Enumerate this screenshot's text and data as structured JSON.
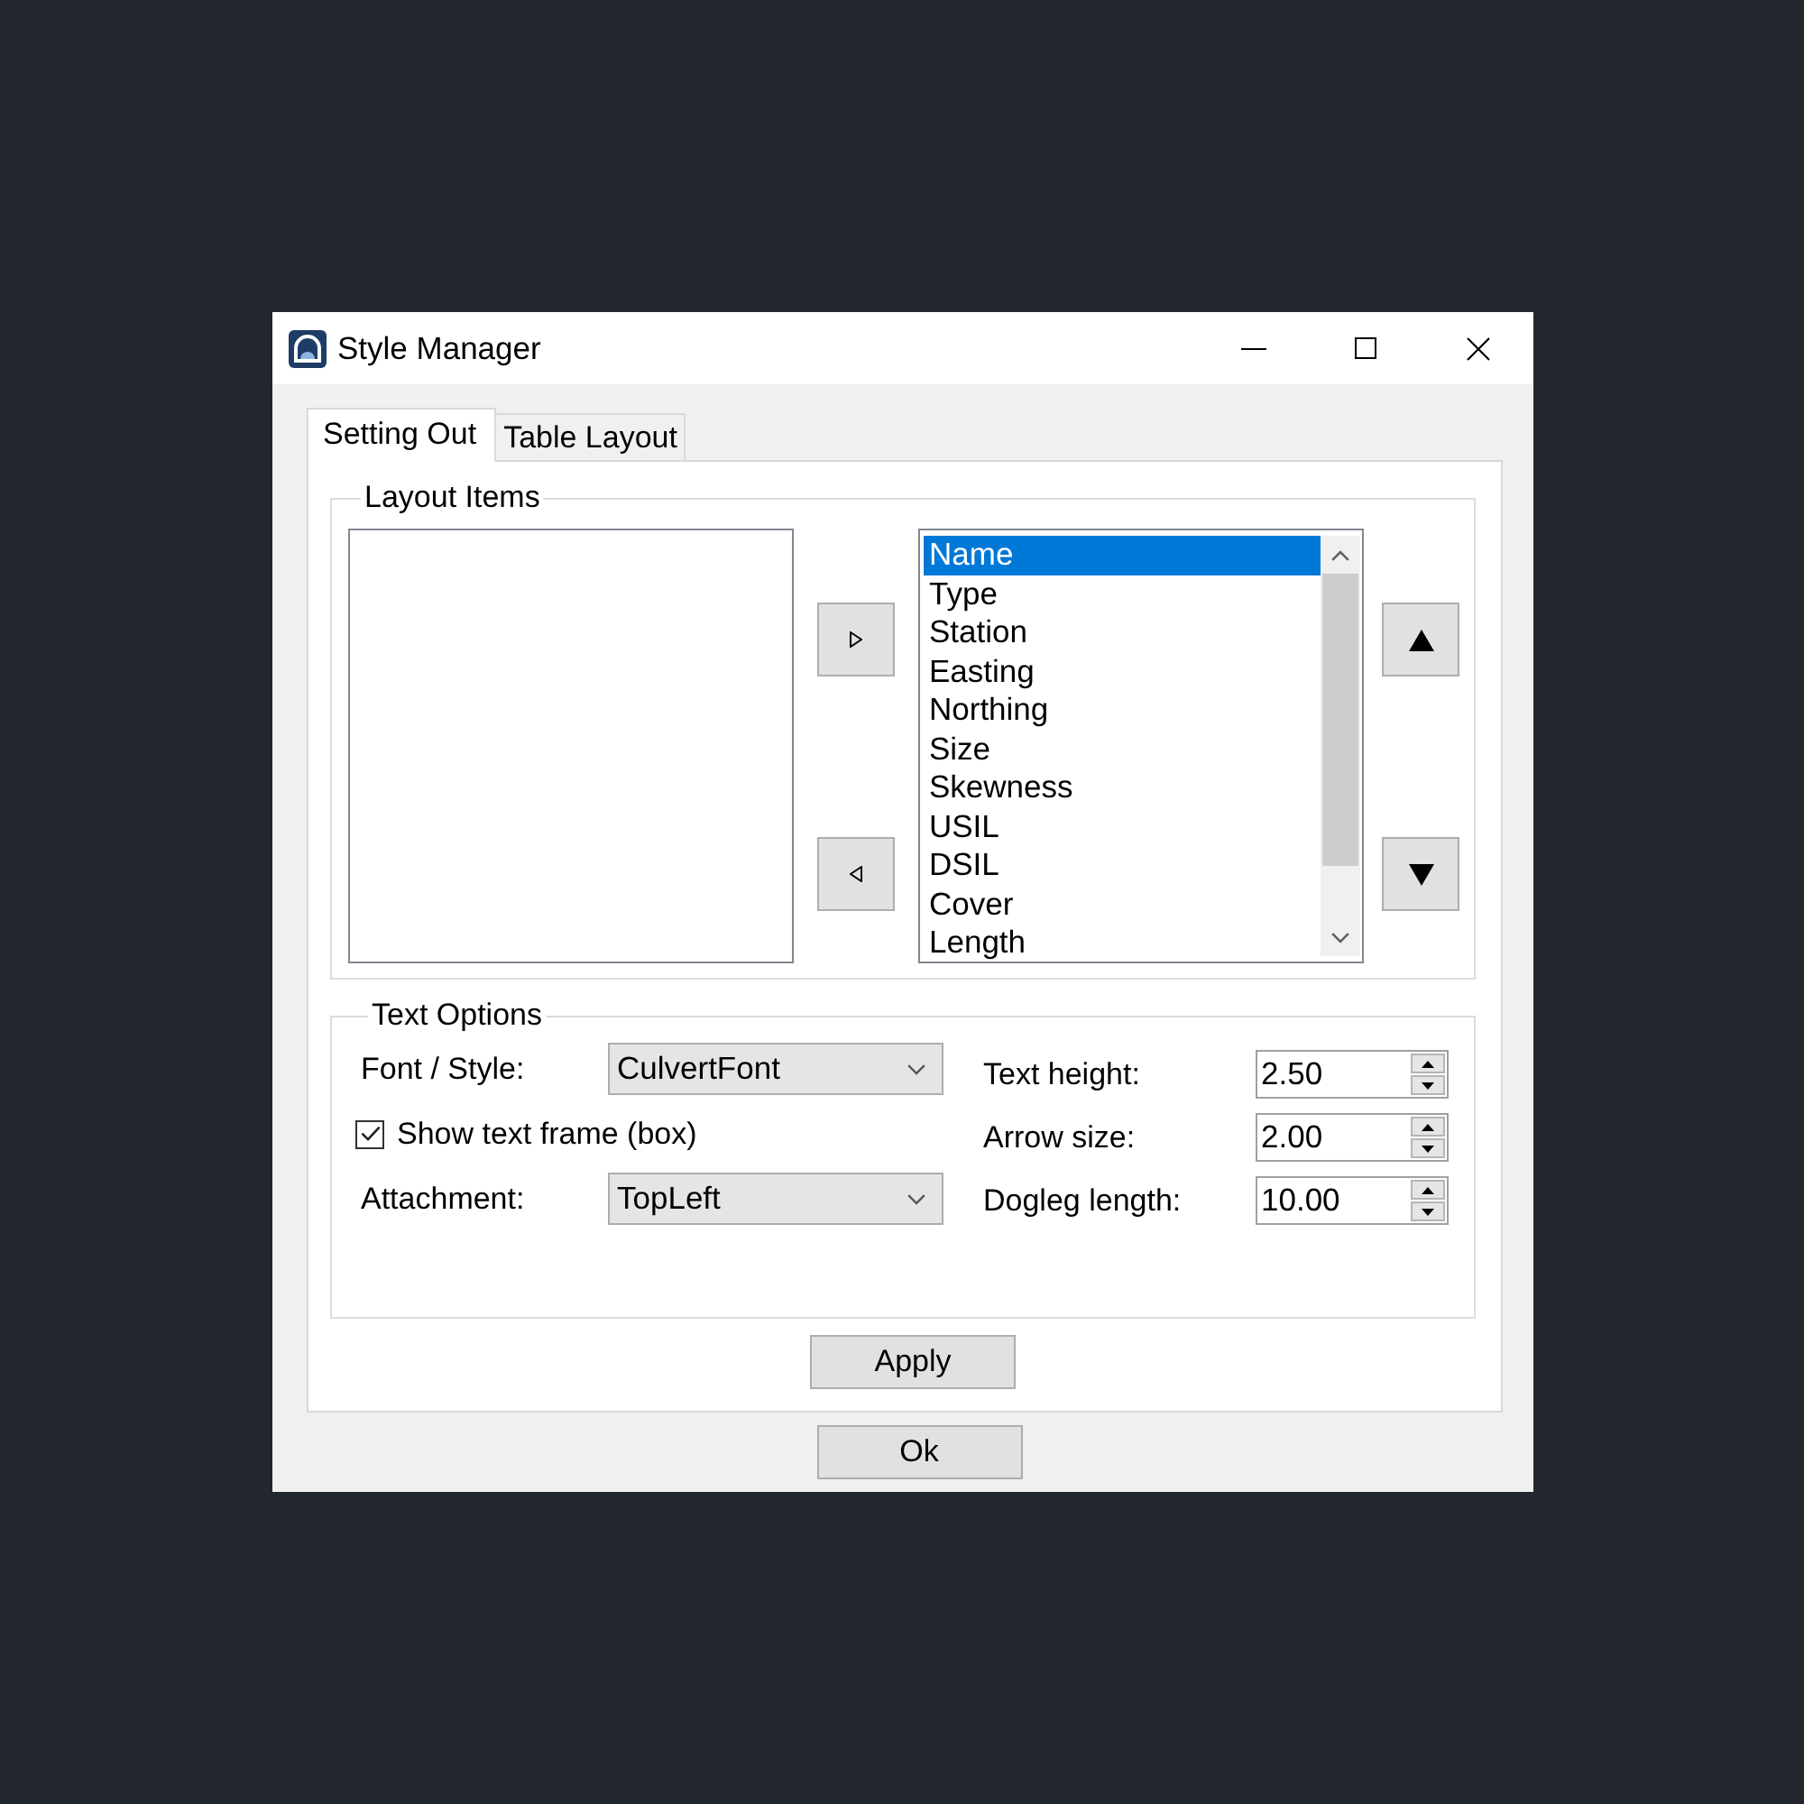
{
  "window": {
    "title": "Style Manager"
  },
  "tabs": [
    {
      "label": "Setting Out",
      "selected": true
    },
    {
      "label": "Table Layout",
      "selected": false
    }
  ],
  "layout_items": {
    "title": "Layout Items",
    "available_list": {
      "items": [
        {
          "label": "Name",
          "selected": true
        },
        {
          "label": "Type",
          "selected": false
        },
        {
          "label": "Station",
          "selected": false
        },
        {
          "label": "Easting",
          "selected": false
        },
        {
          "label": "Northing",
          "selected": false
        },
        {
          "label": "Size",
          "selected": false
        },
        {
          "label": "Skewness",
          "selected": false
        },
        {
          "label": "USIL",
          "selected": false
        },
        {
          "label": "DSIL",
          "selected": false
        },
        {
          "label": "Cover",
          "selected": false
        },
        {
          "label": "Length",
          "selected": false
        }
      ]
    }
  },
  "text_options": {
    "title": "Text Options",
    "font_style": {
      "label": "Font / Style:",
      "value": "CulvertFont"
    },
    "show_text_frame": {
      "label": "Show text frame (box)",
      "checked": true
    },
    "attachment": {
      "label": "Attachment:",
      "value": "TopLeft"
    },
    "numeric_fields": [
      {
        "label": "Text height:",
        "value": "2.50"
      },
      {
        "label": "Arrow size:",
        "value": "2.00"
      },
      {
        "label": "Dogleg length:",
        "value": "10.00"
      }
    ]
  },
  "apply_button": {
    "label": "Apply"
  },
  "ok_button": {
    "label": "Ok"
  }
}
